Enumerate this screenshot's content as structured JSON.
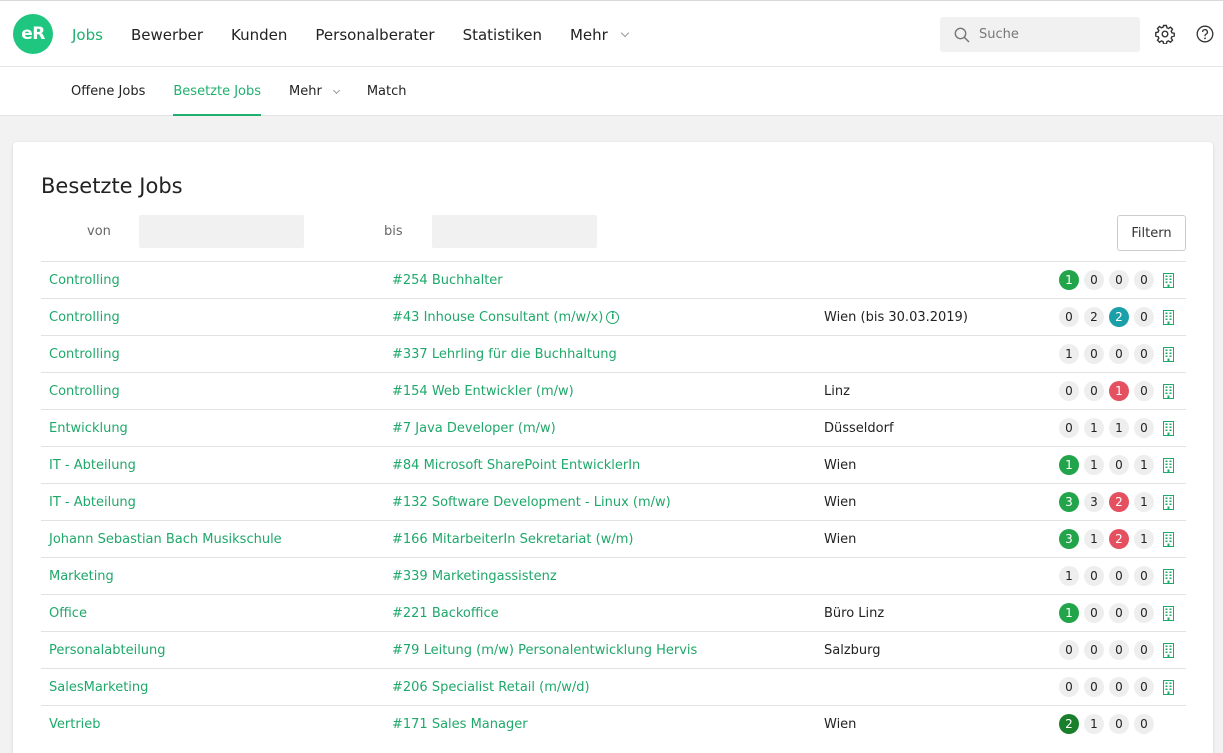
{
  "app": {
    "logo_text": "eR"
  },
  "nav": {
    "items": [
      "Jobs",
      "Bewerber",
      "Kunden",
      "Personalberater",
      "Statistiken",
      "Mehr"
    ],
    "active": "Jobs"
  },
  "search": {
    "placeholder": "Suche"
  },
  "subnav": {
    "items": [
      "Offene Jobs",
      "Besetzte Jobs",
      "Mehr",
      "Match"
    ],
    "active": "Besetzte Jobs"
  },
  "page": {
    "title": "Besetzte Jobs",
    "from_label": "von",
    "to_label": "bis",
    "filter_button": "Filtern"
  },
  "colors": {
    "brand": "#1fc67f",
    "link": "#1fa86a",
    "badge_green": "#22a44a",
    "badge_dark_green": "#1a7f2a",
    "badge_teal": "#1ba0a9",
    "badge_red": "#e45060"
  },
  "rows": [
    {
      "dept": "Controlling",
      "job": "#254 Buchhalter",
      "location": "",
      "info": false,
      "badges": [
        {
          "v": "1",
          "c": "green"
        },
        {
          "v": "0",
          "c": ""
        },
        {
          "v": "0",
          "c": ""
        },
        {
          "v": "0",
          "c": ""
        }
      ],
      "building": true
    },
    {
      "dept": "Controlling",
      "job": "#43 Inhouse Consultant (m/w/x)",
      "location": "Wien (bis 30.03.2019)",
      "info": true,
      "badges": [
        {
          "v": "0",
          "c": ""
        },
        {
          "v": "2",
          "c": ""
        },
        {
          "v": "2",
          "c": "teal"
        },
        {
          "v": "0",
          "c": ""
        }
      ],
      "building": true
    },
    {
      "dept": "Controlling",
      "job": "#337 Lehrling für die Buchhaltung",
      "location": "",
      "info": false,
      "badges": [
        {
          "v": "1",
          "c": ""
        },
        {
          "v": "0",
          "c": ""
        },
        {
          "v": "0",
          "c": ""
        },
        {
          "v": "0",
          "c": ""
        }
      ],
      "building": true
    },
    {
      "dept": "Controlling",
      "job": "#154 Web Entwickler (m/w)",
      "location": "Linz",
      "info": false,
      "badges": [
        {
          "v": "0",
          "c": ""
        },
        {
          "v": "0",
          "c": ""
        },
        {
          "v": "1",
          "c": "red"
        },
        {
          "v": "0",
          "c": ""
        }
      ],
      "building": true
    },
    {
      "dept": "Entwicklung",
      "job": "#7 Java Developer (m/w)",
      "location": "Düsseldorf",
      "info": false,
      "badges": [
        {
          "v": "0",
          "c": ""
        },
        {
          "v": "1",
          "c": ""
        },
        {
          "v": "1",
          "c": ""
        },
        {
          "v": "0",
          "c": ""
        }
      ],
      "building": true
    },
    {
      "dept": "IT - Abteilung",
      "job": "#84 Microsoft SharePoint EntwicklerIn",
      "location": "Wien",
      "info": false,
      "badges": [
        {
          "v": "1",
          "c": "green"
        },
        {
          "v": "1",
          "c": ""
        },
        {
          "v": "0",
          "c": ""
        },
        {
          "v": "1",
          "c": ""
        }
      ],
      "building": true
    },
    {
      "dept": "IT - Abteilung",
      "job": "#132 Software Development - Linux (m/w)",
      "location": "Wien",
      "info": false,
      "badges": [
        {
          "v": "3",
          "c": "green"
        },
        {
          "v": "3",
          "c": ""
        },
        {
          "v": "2",
          "c": "red"
        },
        {
          "v": "1",
          "c": ""
        }
      ],
      "building": true
    },
    {
      "dept": "Johann Sebastian Bach Musikschule",
      "job": "#166 MitarbeiterIn Sekretariat (w/m)",
      "location": "Wien",
      "info": false,
      "badges": [
        {
          "v": "3",
          "c": "green"
        },
        {
          "v": "1",
          "c": ""
        },
        {
          "v": "2",
          "c": "red"
        },
        {
          "v": "1",
          "c": ""
        }
      ],
      "building": true
    },
    {
      "dept": "Marketing",
      "job": "#339 Marketingassistenz",
      "location": "",
      "info": false,
      "badges": [
        {
          "v": "1",
          "c": ""
        },
        {
          "v": "0",
          "c": ""
        },
        {
          "v": "0",
          "c": ""
        },
        {
          "v": "0",
          "c": ""
        }
      ],
      "building": true
    },
    {
      "dept": "Office",
      "job": "#221 Backoffice",
      "location": "Büro Linz",
      "info": false,
      "badges": [
        {
          "v": "1",
          "c": "green"
        },
        {
          "v": "0",
          "c": ""
        },
        {
          "v": "0",
          "c": ""
        },
        {
          "v": "0",
          "c": ""
        }
      ],
      "building": true
    },
    {
      "dept": "Personalabteilung",
      "job": "#79 Leitung (m/w) Personalentwicklung Hervis",
      "location": "Salzburg",
      "info": false,
      "badges": [
        {
          "v": "0",
          "c": ""
        },
        {
          "v": "0",
          "c": ""
        },
        {
          "v": "0",
          "c": ""
        },
        {
          "v": "0",
          "c": ""
        }
      ],
      "building": true
    },
    {
      "dept": "SalesMarketing",
      "job": "#206 Specialist Retail (m/w/d)",
      "location": "",
      "info": false,
      "badges": [
        {
          "v": "0",
          "c": ""
        },
        {
          "v": "0",
          "c": ""
        },
        {
          "v": "0",
          "c": ""
        },
        {
          "v": "0",
          "c": ""
        }
      ],
      "building": true
    },
    {
      "dept": "Vertrieb",
      "job": "#171 Sales Manager",
      "location": "Wien",
      "info": false,
      "badges": [
        {
          "v": "2",
          "c": "darkgreen"
        },
        {
          "v": "1",
          "c": ""
        },
        {
          "v": "0",
          "c": ""
        },
        {
          "v": "0",
          "c": ""
        }
      ],
      "building": false
    }
  ]
}
